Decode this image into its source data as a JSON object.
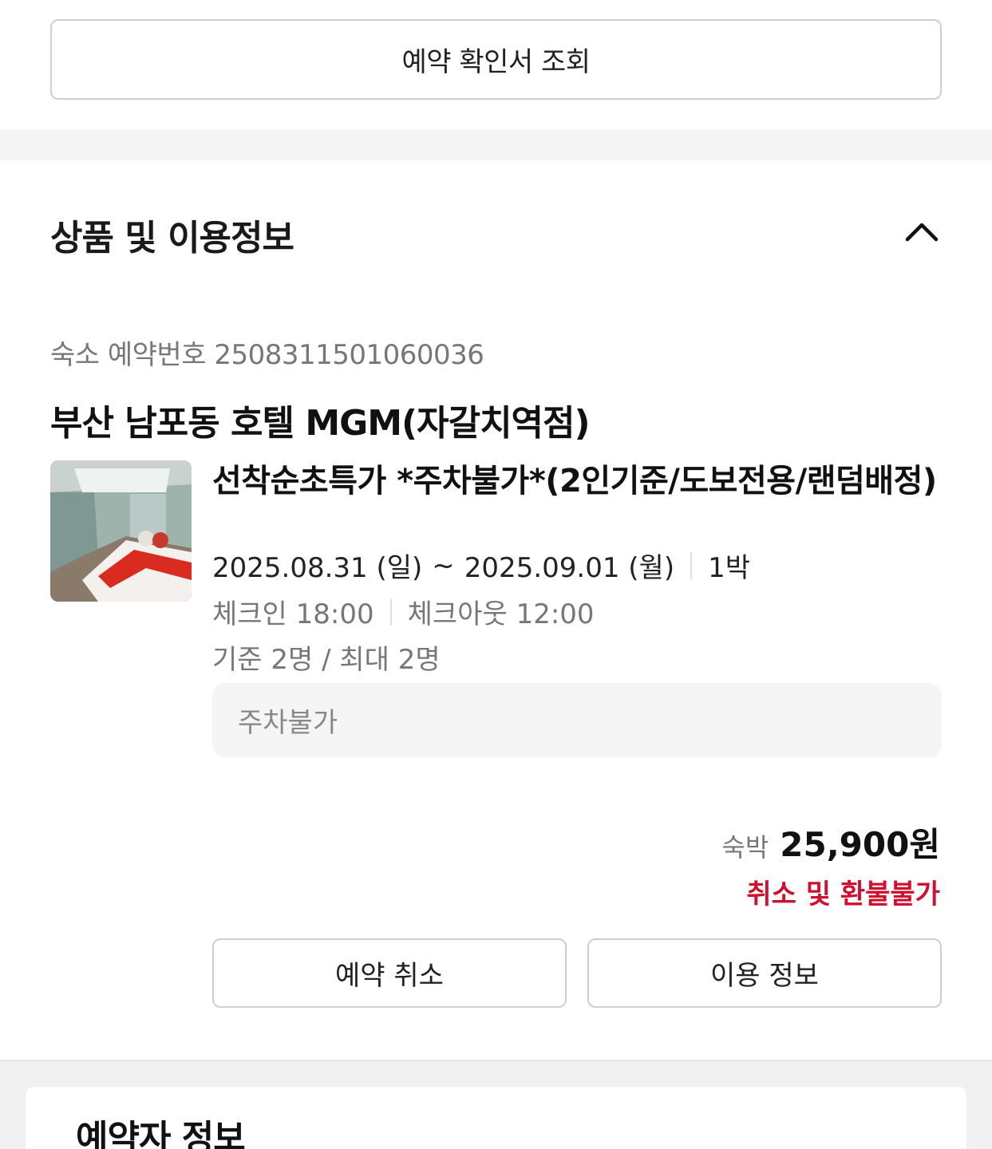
{
  "top": {
    "confirmation_button_label": "예약 확인서 조회"
  },
  "section": {
    "title": "상품 및 이용정보",
    "toggle_icon": "chevron-up-icon"
  },
  "reservation": {
    "number_label": "숙소 예약번호",
    "number": "2508311501060036",
    "hotel_name": "부산 남포동 호텔 MGM(자갈치역점)",
    "room_name": "선착순초특가 *주차불가*(2인기준/도보전용/랜덤배정)",
    "check_in_date": "2025.08.31 (일)",
    "date_separator": "~",
    "check_out_date": "2025.09.01 (월)",
    "nights": "1박",
    "check_in_time": "체크인 18:00",
    "check_out_time": "체크아웃 12:00",
    "capacity": "기준 2명 / 최대 2명",
    "note": "주차불가",
    "price_label": "숙박",
    "price": "25,900원",
    "refund_policy": "취소 및 환불불가"
  },
  "actions": {
    "cancel_label": "예약 취소",
    "info_label": "이용 정보"
  },
  "next_section": {
    "title": "예약자 정보"
  },
  "colors": {
    "accent_red": "#d0102f",
    "border": "#cfcfcf",
    "muted_text": "#777777"
  }
}
